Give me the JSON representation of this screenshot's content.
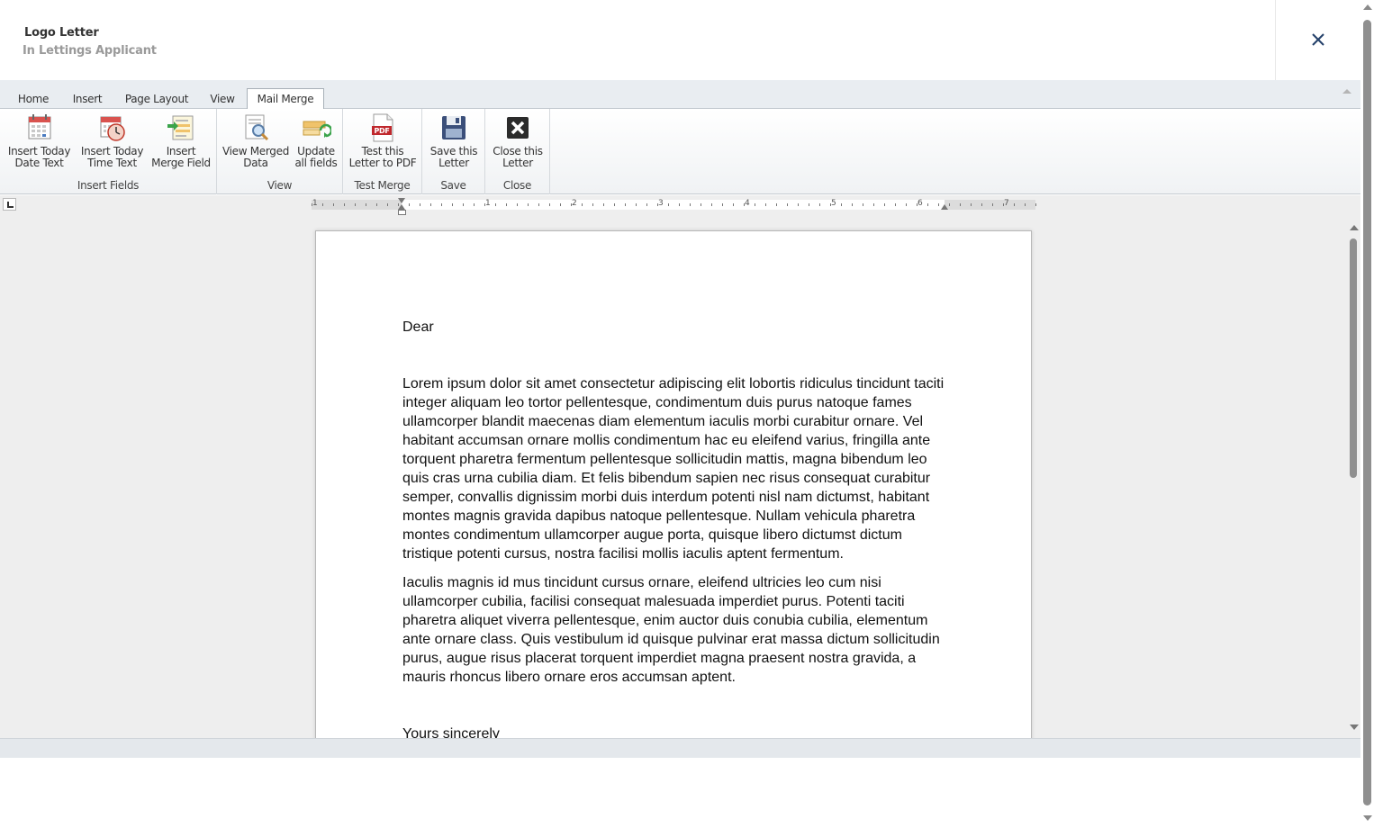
{
  "header": {
    "title": "Logo Letter",
    "subtitle": "In Lettings Applicant"
  },
  "ribbon": {
    "tabs": [
      {
        "label": "Home"
      },
      {
        "label": "Insert"
      },
      {
        "label": "Page Layout"
      },
      {
        "label": "View"
      },
      {
        "label": "Mail Merge"
      }
    ],
    "active_tab": "Mail Merge",
    "groups": {
      "insert_fields": {
        "name": "Insert Fields",
        "buttons": [
          {
            "label": "Insert Today\nDate Text",
            "icon": "calendar-date-icon"
          },
          {
            "label": "Insert Today\nTime Text",
            "icon": "calendar-clock-icon"
          },
          {
            "label": "Insert\nMerge Field",
            "icon": "merge-field-icon"
          }
        ]
      },
      "view": {
        "name": "View",
        "buttons": [
          {
            "label": "View Merged\nData",
            "icon": "document-magnifier-icon"
          },
          {
            "label": "Update\nall fields",
            "icon": "refresh-fields-icon"
          }
        ]
      },
      "test_merge": {
        "name": "Test Merge",
        "buttons": [
          {
            "label": "Test this\nLetter to PDF",
            "icon": "pdf-icon",
            "badge": "PDF"
          }
        ]
      },
      "save": {
        "name": "Save",
        "buttons": [
          {
            "label": "Save this\nLetter",
            "icon": "floppy-disk-icon"
          }
        ]
      },
      "close": {
        "name": "Close",
        "buttons": [
          {
            "label": "Close this\nLetter",
            "icon": "close-x-icon"
          }
        ]
      }
    }
  },
  "ruler": {
    "labels": [
      "1",
      "1",
      "2",
      "3",
      "4",
      "5",
      "6",
      "7"
    ]
  },
  "document": {
    "greeting": "Dear",
    "paragraphs": [
      "Lorem ipsum dolor sit amet consectetur adipiscing elit lobortis ridiculus tincidunt taciti integer aliquam leo tortor pellentesque, condimentum duis purus natoque fames ullamcorper blandit maecenas diam elementum iaculis morbi curabitur ornare. Vel habitant accumsan ornare mollis condimentum hac eu eleifend varius, fringilla ante torquent pharetra fermentum pellentesque sollicitudin mattis, magna bibendum leo quis cras urna cubilia diam. Et felis bibendum sapien nec risus consequat curabitur semper, convallis dignissim morbi duis interdum potenti nisl nam dictumst, habitant montes magnis gravida dapibus natoque pellentesque. Nullam vehicula pharetra montes condimentum ullamcorper augue porta, quisque libero dictumst dictum tristique potenti cursus, nostra facilisi mollis iaculis aptent fermentum.",
      "Iaculis magnis id mus tincidunt cursus ornare, eleifend ultricies leo cum nisi ullamcorper cubilia, facilisi consequat malesuada imperdiet purus. Potenti taciti pharetra aliquet viverra pellentesque, enim auctor duis conubia cubilia, elementum ante ornare class. Quis vestibulum id quisque pulvinar erat massa dictum sollicitudin purus, augue risus placerat torquent imperdiet magna praesent nostra gravida, a mauris rhoncus libero ornare eros accumsan aptent."
    ],
    "closing": "Yours sincerely"
  }
}
